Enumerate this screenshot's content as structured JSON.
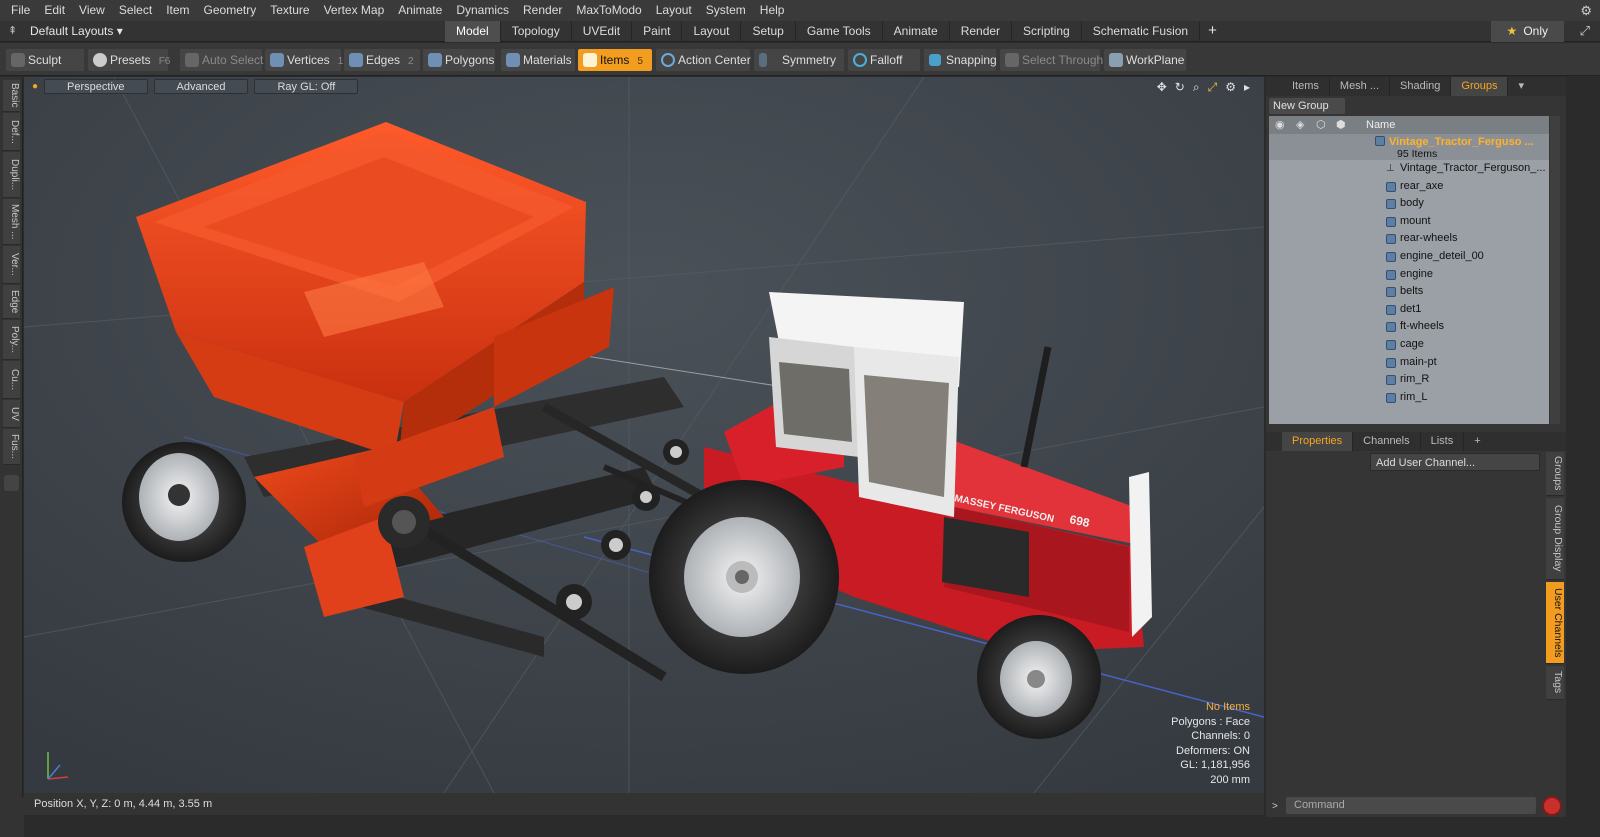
{
  "menu": [
    "File",
    "Edit",
    "View",
    "Select",
    "Item",
    "Geometry",
    "Texture",
    "Vertex Map",
    "Animate",
    "Dynamics",
    "Render",
    "MaxToModo",
    "Layout",
    "System",
    "Help"
  ],
  "layout_selector": "Default Layouts ▾",
  "tabs": [
    "Model",
    "Topology",
    "UVEdit",
    "Paint",
    "Layout",
    "Setup",
    "Game Tools",
    "Animate",
    "Render",
    "Scripting",
    "Schematic Fusion"
  ],
  "active_tab": "Model",
  "only_label": "Only",
  "toolbar": {
    "sculpt": "Sculpt",
    "presets": "Presets",
    "presets_key": "F6",
    "auto_select": "Auto Select",
    "vertices": "Vertices",
    "vertices_key": "1",
    "edges": "Edges",
    "edges_key": "2",
    "polygons": "Polygons",
    "materials": "Materials",
    "items": "Items",
    "items_key": "5",
    "action_center": "Action Center",
    "symmetry": "Symmetry",
    "falloff": "Falloff",
    "snapping": "Snapping",
    "select_through": "Select Through",
    "workplane": "WorkPlane"
  },
  "left_tabs": [
    "Basic",
    "Def...",
    "Dupli...",
    "Mesh ...",
    "Ver...",
    "Edge",
    "Poly...",
    "Cu...",
    "UV",
    "Fus..."
  ],
  "viewport": {
    "perspective": "Perspective",
    "advanced": "Advanced",
    "raygl": "Ray GL: Off",
    "decal": "MASSEY FERGUSON",
    "model_no": "698",
    "info": {
      "no_items": "No Items",
      "polygons": "Polygons : Face",
      "channels": "Channels: 0",
      "deformers": "Deformers: ON",
      "gl": "GL: 1,181,956",
      "scale": "200 mm"
    }
  },
  "position_bar": "Position X, Y, Z:   0 m, 4.44 m, 3.55 m",
  "right_panel": {
    "tabs": [
      "Items",
      "Mesh ...",
      "Shading",
      "Groups"
    ],
    "active_tab": "Groups",
    "new_group": "New Group",
    "column_name": "Name",
    "root_name": "Vintage_Tractor_Ferguso ...",
    "root_count": "95 Items",
    "children": [
      "Vintage_Tractor_Ferguson_...",
      "rear_axe",
      "body",
      "mount",
      "rear-wheels",
      "engine_deteil_00",
      "engine",
      "belts",
      "det1",
      "ft-wheels",
      "cage",
      "main-pt",
      "rim_R",
      "rim_L"
    ],
    "prop_tabs": [
      "Properties",
      "Channels",
      "Lists"
    ],
    "active_prop_tab": "Properties",
    "add_user_channel": "Add User Channel...",
    "side_tabs": [
      "Groups",
      "Group Display",
      "User Channels",
      "Tags"
    ],
    "active_side_tab": "User Channels",
    "command_placeholder": "Command"
  },
  "colors": {
    "accent": "#f29d20",
    "spreader": "#e8421c",
    "tractor_red": "#d8202a",
    "viewport_bg": "#3d4349"
  }
}
